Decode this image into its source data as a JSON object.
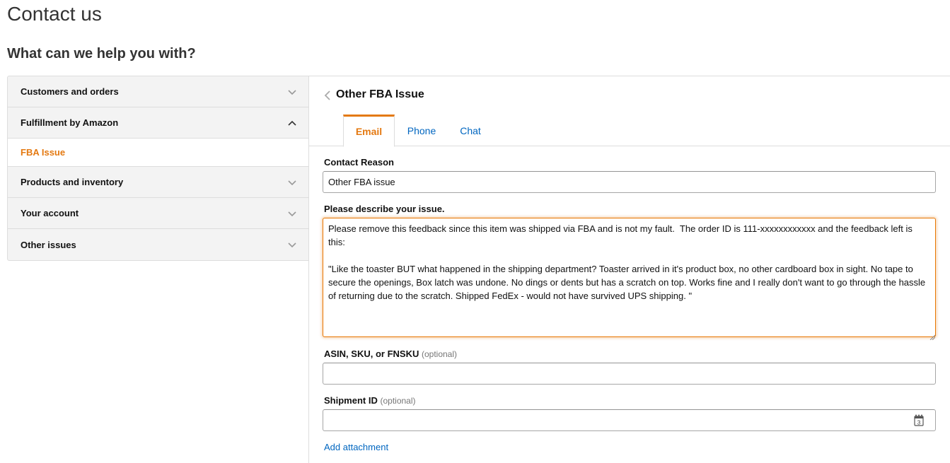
{
  "page": {
    "title": "Contact us",
    "subtitle": "What can we help you with?"
  },
  "accordion": {
    "items": [
      {
        "label": "Customers and orders",
        "state": "collapsed"
      },
      {
        "label": "Fulfillment by Amazon",
        "state": "expanded"
      },
      {
        "label": "FBA Issue",
        "state": "selected-sub"
      },
      {
        "label": "Products and inventory",
        "state": "collapsed"
      },
      {
        "label": "Your account",
        "state": "collapsed"
      },
      {
        "label": "Other issues",
        "state": "collapsed"
      }
    ]
  },
  "panel": {
    "title": "Other FBA Issue",
    "tabs": [
      {
        "label": "Email",
        "active": true
      },
      {
        "label": "Phone",
        "active": false
      },
      {
        "label": "Chat",
        "active": false
      }
    ],
    "contact_reason": {
      "label": "Contact Reason",
      "value": "Other FBA issue"
    },
    "describe": {
      "label": "Please describe your issue.",
      "value": "Please remove this feedback since this item was shipped via FBA and is not my fault.  The order ID is 111-xxxxxxxxxxxx and the feedback left is this:\n\n\"Like the toaster BUT what happened in the shipping department? Toaster arrived in it's product box, no other cardboard box in sight. No tape to secure the openings, Box latch was undone. No dings or dents but has a scratch on top. Works fine and I really don't want to go through the hassle of returning due to the scratch. Shipped FedEx - would not have survived UPS shipping. \""
    },
    "asin": {
      "label": "ASIN, SKU, or FNSKU",
      "optional": "(optional)",
      "value": ""
    },
    "shipment": {
      "label": "Shipment ID",
      "optional": "(optional)",
      "value": "",
      "calendar_day": "3"
    },
    "attachment_link": "Add attachment"
  },
  "colors": {
    "accent_orange": "#e47911",
    "link_blue": "#0066c0",
    "border": "#dddddd",
    "accordion_bg": "#f3f3f3"
  },
  "icons": {
    "collapsed": "chevron-down-icon",
    "expanded": "chevron-up-icon",
    "back": "chevron-left-icon",
    "calendar": "calendar-icon",
    "resize": "resize-grip-icon"
  }
}
